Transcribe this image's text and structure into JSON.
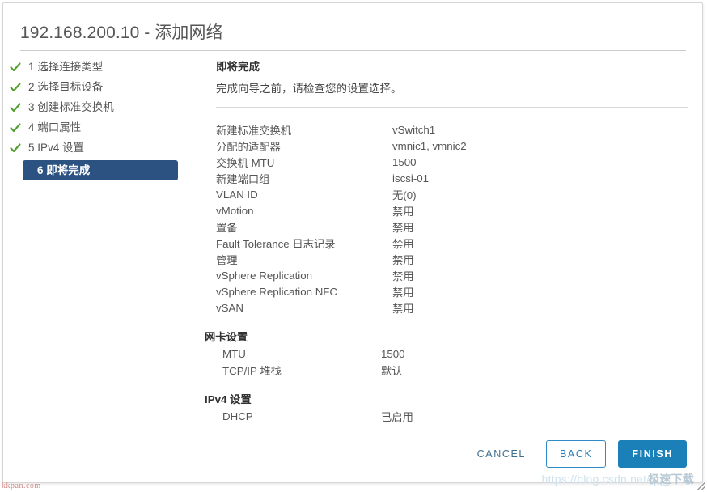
{
  "window": {
    "title": "192.168.200.10 - 添加网络"
  },
  "steps": [
    {
      "num": "1",
      "label": "1 选择连接类型",
      "state": "done",
      "icon": "check-icon"
    },
    {
      "num": "2",
      "label": "2 选择目标设备",
      "state": "done",
      "icon": "check-icon"
    },
    {
      "num": "3",
      "label": "3 创建标准交换机",
      "state": "done",
      "icon": "check-icon"
    },
    {
      "num": "4",
      "label": "4 端口属性",
      "state": "done",
      "icon": "check-icon"
    },
    {
      "num": "5",
      "label": "5 IPv4 设置",
      "state": "done",
      "icon": "check-icon"
    },
    {
      "num": "6",
      "label": "6 即将完成",
      "state": "active",
      "icon": ""
    }
  ],
  "content": {
    "title": "即将完成",
    "subtitle": "完成向导之前，请检查您的设置选择。",
    "summary_rows": [
      {
        "key": "新建标准交换机",
        "value": "vSwitch1"
      },
      {
        "key": "分配的适配器",
        "value": "vmnic1, vmnic2"
      },
      {
        "key": "交换机 MTU",
        "value": "1500"
      },
      {
        "key": "新建端口组",
        "value": "iscsi-01"
      },
      {
        "key": "VLAN ID",
        "value": "无(0)"
      },
      {
        "key": "vMotion",
        "value": "禁用"
      },
      {
        "key": "置备",
        "value": "禁用"
      },
      {
        "key": "Fault Tolerance 日志记录",
        "value": "禁用"
      },
      {
        "key": "管理",
        "value": "禁用"
      },
      {
        "key": "vSphere Replication",
        "value": "禁用"
      },
      {
        "key": "vSphere Replication NFC",
        "value": "禁用"
      },
      {
        "key": "vSAN",
        "value": "禁用"
      }
    ],
    "groups": [
      {
        "title": "网卡设置",
        "rows": [
          {
            "key": "MTU",
            "value": "1500"
          },
          {
            "key": "TCP/IP 堆栈",
            "value": "默认"
          }
        ]
      },
      {
        "title": "IPv4 设置",
        "rows": [
          {
            "key": "DHCP",
            "value": "已启用"
          }
        ]
      }
    ]
  },
  "footer": {
    "cancel_label": "CANCEL",
    "back_label": "BACK",
    "finish_label": "FINISH"
  },
  "watermarks": {
    "bottom_left": "kkpan.com",
    "bottom_right": "https://blog.csdn.net/qq_",
    "bottom_right_overlay": "极速下载"
  },
  "colors": {
    "active_step_bg": "#2c5281",
    "primary_button_bg": "#1b7fb8",
    "outline_button_border": "#2e8bc6",
    "check_green": "#4f9e2e",
    "title_text": "#565656"
  }
}
